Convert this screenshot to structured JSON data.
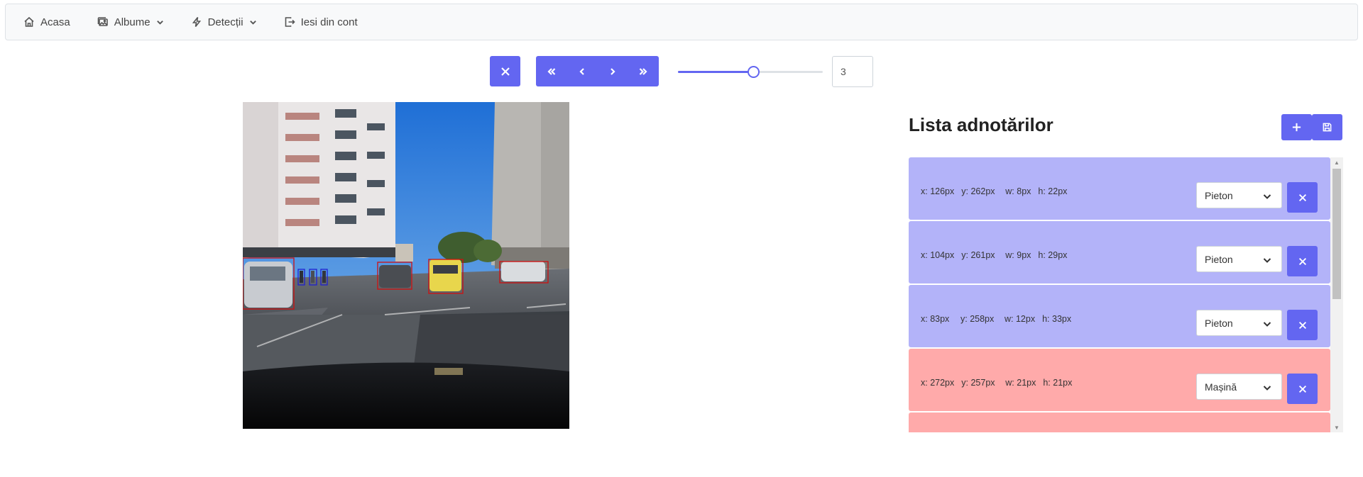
{
  "nav": {
    "home": "Acasa",
    "albums": "Albume",
    "detections": "Detecții",
    "logout": "Iesi din cont"
  },
  "toolbar": {
    "level_value": "3",
    "slider_level_fraction": 0.52
  },
  "panel": {
    "title": "Lista adnotărilor"
  },
  "annotations": [
    {
      "x": "x: 126px",
      "y": "y: 262px",
      "w": "w: 8px",
      "h": "h: 22px",
      "type": "Pieton",
      "kind": "pieton"
    },
    {
      "x": "x: 104px",
      "y": "y: 261px",
      "w": "w: 9px",
      "h": "h: 29px",
      "type": "Pieton",
      "kind": "pieton"
    },
    {
      "x": "x: 83px",
      "y": "y: 258px",
      "w": "w: 12px",
      "h": "h: 33px",
      "type": "Pieton",
      "kind": "pieton"
    },
    {
      "x": "x: 272px",
      "y": "y: 257px",
      "w": "w: 21px",
      "h": "h: 21px",
      "type": "Mașină",
      "kind": "masina"
    }
  ],
  "colors": {
    "accent": "#6366f1",
    "pieton_row": "#b3b3f9",
    "masina_row": "#ffaaaa",
    "pieton_box": "#2020d0",
    "masina_box": "#d01010"
  }
}
